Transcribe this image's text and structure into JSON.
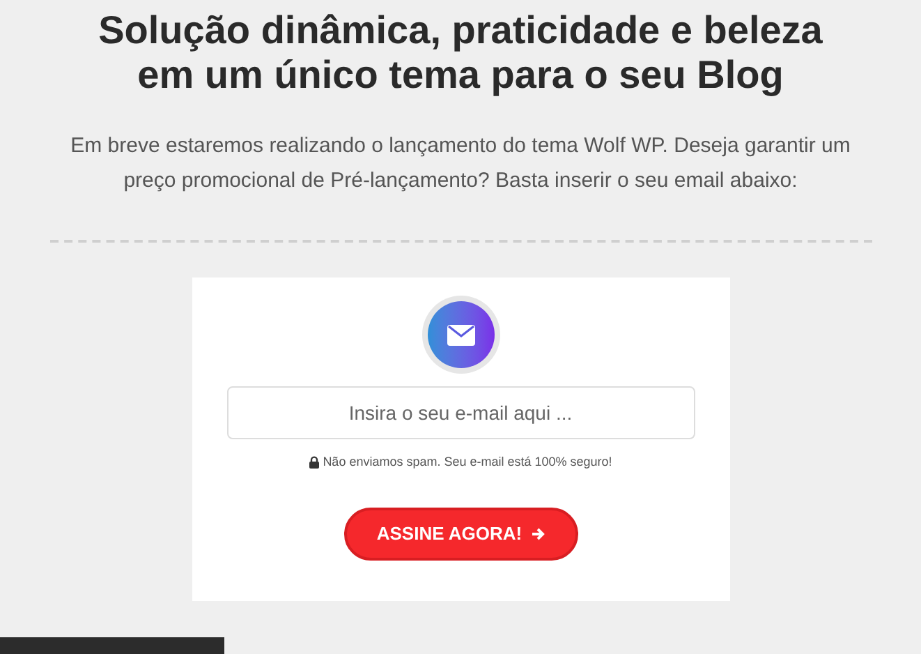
{
  "heading": "Solução dinâmica, praticidade e beleza em um único tema para o seu Blog",
  "intro": "Em breve estaremos realizando o lançamento do tema Wolf WP. Deseja garantir um preço promocional de Pré-lançamento? Basta inserir o seu email abaixo:",
  "form": {
    "email": {
      "placeholder": "Insira o seu e-mail aqui ..."
    },
    "note": "Não enviamos spam. Seu e-mail está 100% seguro!",
    "button": "ASSINE AGORA!"
  }
}
